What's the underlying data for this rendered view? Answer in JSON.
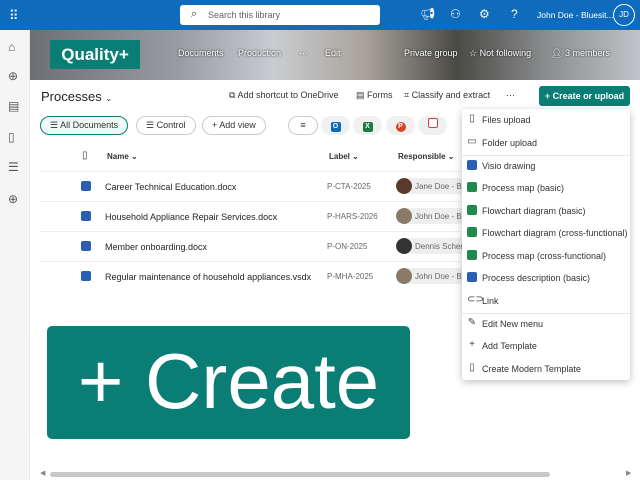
{
  "topbar": {
    "search_placeholder": "Search this library",
    "user": "John Doe - Bluesit...",
    "avatar": "JD"
  },
  "site": {
    "logo": "Quality+",
    "nav": [
      "Documents",
      "Production",
      "···",
      "Edit"
    ],
    "privacy": "Private group",
    "follow": "Not following",
    "members": "3 members"
  },
  "library": {
    "title": "Processes",
    "commands": [
      "Add shortcut to OneDrive",
      "Forms",
      "Classify and extract",
      "···"
    ],
    "create": "Create or upload"
  },
  "views": {
    "all": "All Documents",
    "control": "Control",
    "add": "Add view"
  },
  "columns": {
    "name": "Name",
    "label": "Label",
    "responsible": "Responsible"
  },
  "rows": [
    {
      "name": "Career Technical Education.docx",
      "label": "P-CTA-2025",
      "responsible": "Jane Doe - Blu"
    },
    {
      "name": "Household Appliance Repair Services.docx",
      "label": "P-HARS-2026",
      "responsible": "John Doe - Blu"
    },
    {
      "name": "Member onboarding.docx",
      "label": "P-ON-2025",
      "responsible": "Dennis Scherr"
    },
    {
      "name": "Regular maintenance of household appliances.vsdx",
      "label": "P-MHA-2025",
      "responsible": "John Doe - Blu"
    }
  ],
  "menu": [
    "Files upload",
    "Folder upload",
    "Visio drawing",
    "Process map (basic)",
    "Flowchart diagram (basic)",
    "Flowchart diagram (cross-functional)",
    "Process map (cross-functional)",
    "Process description (basic)",
    "Link",
    "Edit New menu",
    "Add Template",
    "Create Modern Template"
  ],
  "overlay": "+ Create",
  "colors": {
    "topbar": "#0f6cbd",
    "accent": "#0a7d74"
  }
}
